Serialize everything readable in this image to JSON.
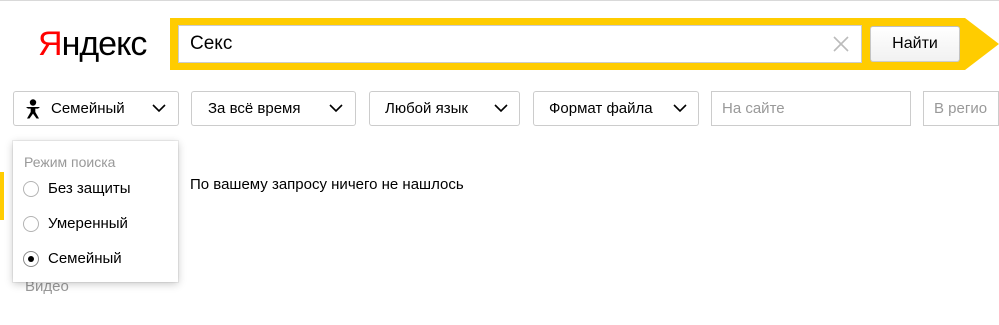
{
  "logo": {
    "first": "Я",
    "rest": "ндекс"
  },
  "search": {
    "query": "Секс",
    "button_label": "Найти"
  },
  "filters": {
    "family": "Семейный",
    "time": "За всё время",
    "language": "Любой язык",
    "format": "Формат файла",
    "site_placeholder": "На сайте",
    "region_placeholder": "В регионе"
  },
  "dropdown": {
    "title": "Режим поиска",
    "options": [
      {
        "label": "Без защиты",
        "selected": false
      },
      {
        "label": "Умеренный",
        "selected": false
      },
      {
        "label": "Семейный",
        "selected": true
      }
    ]
  },
  "results": {
    "message": "По вашему запросу ничего не нашлось"
  },
  "sidebar": {
    "video": "Видео"
  },
  "colors": {
    "brand_yellow": "#ffcc00",
    "logo_red": "#ff0000"
  },
  "icons": {
    "family": "family-filter-icon",
    "clear": "close-icon",
    "chevron": "chevron-down-icon"
  }
}
